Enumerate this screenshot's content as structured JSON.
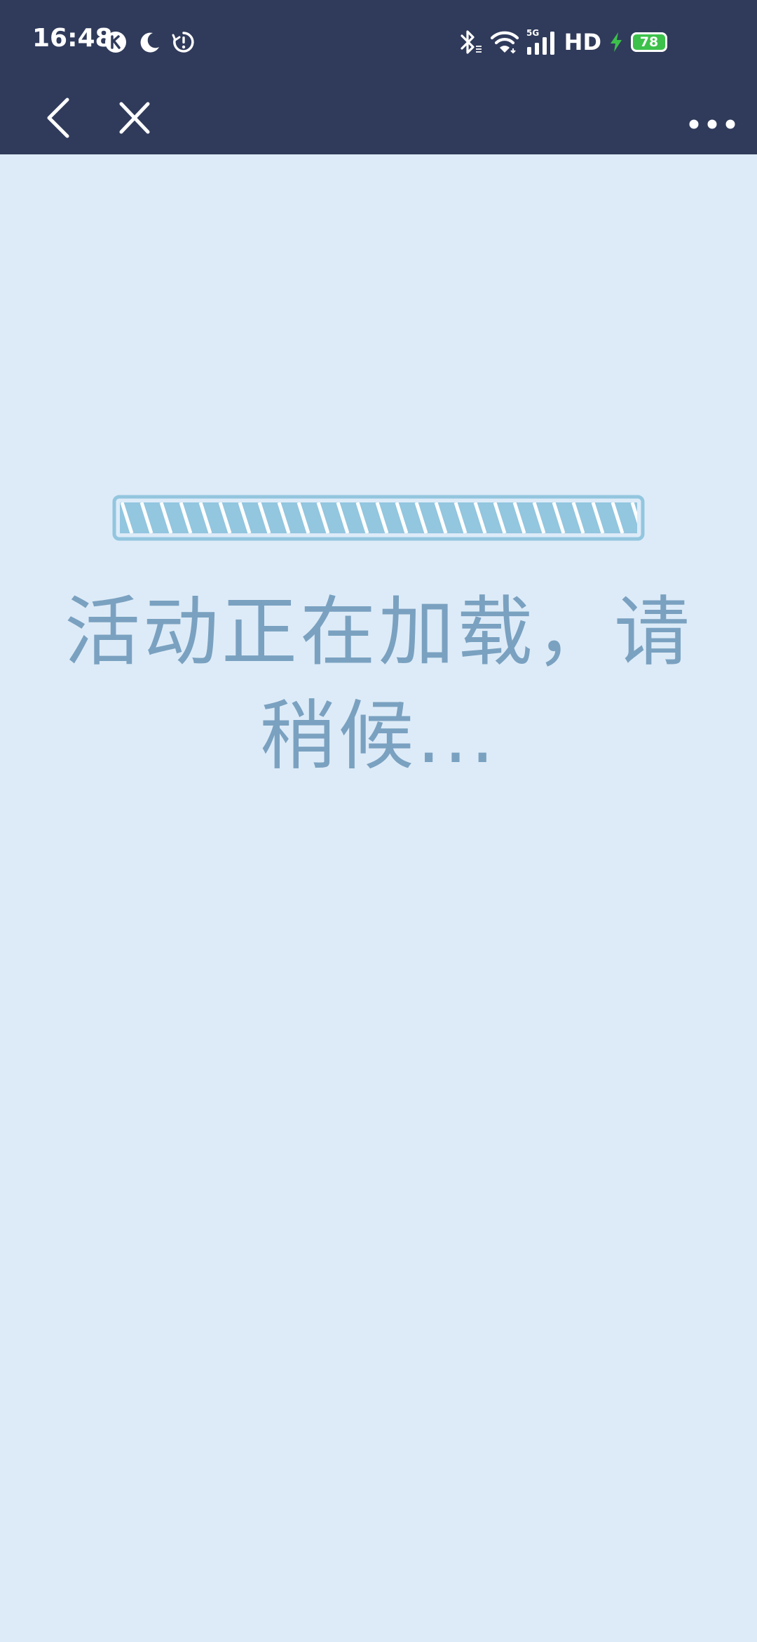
{
  "status_bar": {
    "time": "16:48",
    "left_icons": [
      "k-app-icon",
      "moon-icon",
      "alarm-sync-icon"
    ],
    "right_icons": [
      "bluetooth-icon",
      "wifi-icon",
      "signal-5g-icon"
    ],
    "network_badge": "5G",
    "hd_label": "HD",
    "charging": true,
    "battery_level": "78",
    "battery_color": "#3cc14b"
  },
  "nav": {
    "back_icon": "chevron-left-icon",
    "close_icon": "close-icon",
    "more_icon": "more-dots-icon"
  },
  "content": {
    "loading_text": "活动正在加载，请稍候...",
    "progress_state": "indeterminate-striped",
    "progress_color": "#93c6df"
  },
  "colors": {
    "header_bg": "#303b5b",
    "page_bg": "#ddebf8",
    "text_color": "#7aa1c0"
  }
}
